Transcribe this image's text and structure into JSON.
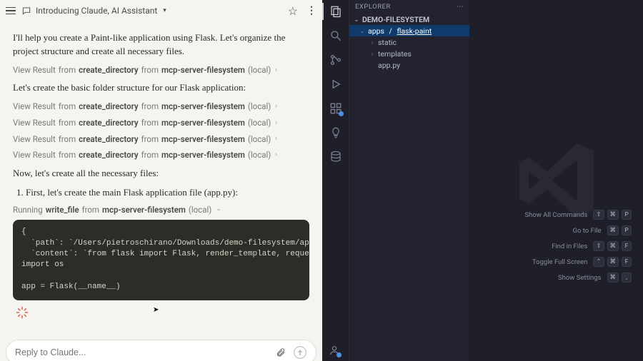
{
  "claude": {
    "title": "Introducing Claude, AI Assistant",
    "paragraphs": {
      "p1": "I'll help you create a Paint-like application using Flask. Let's organize the project structure and create all necessary files.",
      "p2": "Let's create the basic folder structure for our Flask application:",
      "p3": "Now, let's create all the necessary files:",
      "li1": "First, let's create the main Flask application file (app.py):"
    },
    "toolcalls": [
      {
        "label": "View Result",
        "from": "from",
        "tool": "create_directory",
        "from2": "from",
        "server": "mcp-server-filesystem",
        "loc": "(local)"
      },
      {
        "label": "View Result",
        "from": "from",
        "tool": "create_directory",
        "from2": "from",
        "server": "mcp-server-filesystem",
        "loc": "(local)"
      },
      {
        "label": "View Result",
        "from": "from",
        "tool": "create_directory",
        "from2": "from",
        "server": "mcp-server-filesystem",
        "loc": "(local)"
      },
      {
        "label": "View Result",
        "from": "from",
        "tool": "create_directory",
        "from2": "from",
        "server": "mcp-server-filesystem",
        "loc": "(local)"
      },
      {
        "label": "View Result",
        "from": "from",
        "tool": "create_directory",
        "from2": "from",
        "server": "mcp-server-filesystem",
        "loc": "(local)"
      }
    ],
    "running": {
      "label": "Running",
      "tool": "write_file",
      "from": "from",
      "server": "mcp-server-filesystem",
      "loc": "(local)"
    },
    "code": "{\n  `path`: `/Users/pietroschirano/Downloads/demo-filesystem/apps/flask-paint/a\n  `content`: `from flask import Flask, render_template, request, jsonify\nimport os\n\napp = Flask(__name__)",
    "reply_placeholder": "Reply to Claude..."
  },
  "vscode": {
    "explorer_title": "EXPLORER",
    "root": "DEMO-FILESYSTEM",
    "tree": {
      "apps": "apps",
      "flask_paint": "flask-paint",
      "static": "static",
      "templates": "templates",
      "app_py": "app.py"
    },
    "shortcuts": [
      {
        "label": "Show All Commands",
        "keys": [
          "⇧",
          "⌘",
          "P"
        ]
      },
      {
        "label": "Go to File",
        "keys": [
          "⌘",
          "P"
        ]
      },
      {
        "label": "Find in Files",
        "keys": [
          "⇧",
          "⌘",
          "F"
        ]
      },
      {
        "label": "Toggle Full Screen",
        "keys": [
          "⌃",
          "⌘",
          "F"
        ]
      },
      {
        "label": "Show Settings",
        "keys": [
          "⌘",
          ","
        ]
      }
    ]
  }
}
